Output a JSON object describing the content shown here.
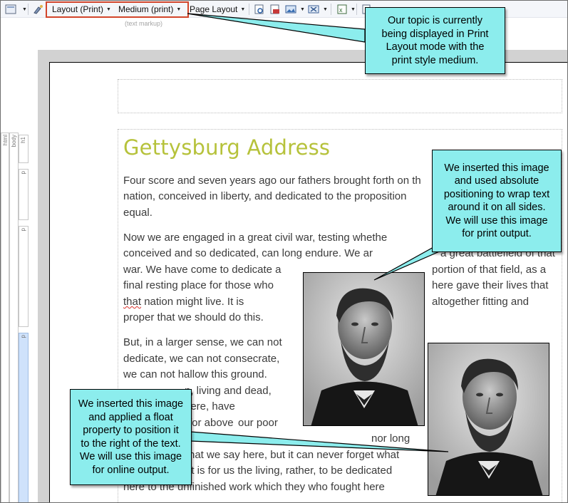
{
  "toolbar": {
    "layout_dropdown": "Layout (Print)",
    "medium_dropdown": "Medium (print)",
    "page_layout_dropdown": "Page Layout",
    "markup_label": "(text markup)"
  },
  "structure_bars": [
    "html",
    "body",
    "h1",
    "p",
    "p",
    "p"
  ],
  "document": {
    "title": "Gettysburg Address",
    "lines": [
      "Four score and seven years ago our fathers brought forth on th",
      "nation, conceived in liberty, and dedicated to the proposition",
      "equal.",
      "Now we are engaged in a great civil war, testing whethe",
      "conceived and so dedicated, can long endure. We ar",
      "war. We have come to dedicate a",
      "final resting place for those who",
      "that nation might live. It is",
      "proper that we should do this.",
      "But, in a larger sense, we can not",
      "dedicate, we can not consecrate,",
      "we can not hallow this ground.",
      "n, living and dead,",
      "here, have",
      "our poor",
      "hat we say here, but it can never forget what",
      "it is for us the living, rather, to be dedicated",
      "here to the unfinished work which they who fought here"
    ],
    "right_col": [
      "a great battlefield of that",
      "portion of that field, as a",
      "here gave their lives that",
      "altogether fitting and"
    ],
    "fragments": [
      "for above",
      "nor long"
    ],
    "misspelled_word": "that"
  },
  "callouts": {
    "print_mode": "Our topic is currently\nbeing displayed in Print\nLayout mode with the\nprint style medium.",
    "absolute_image": "We inserted this image\nand used absolute\npositioning to wrap text\naround it on all sides.\nWe will use this image\nfor print output.",
    "float_image": "We inserted this image\nand applied a float\nproperty to position it\nto the right of the text.\nWe will use this image\nfor online output."
  },
  "colors": {
    "title": "#b6c23b",
    "callout_fill": "#8ceded",
    "highlight_box": "#d2452b",
    "canvas": "#d2d2d2"
  }
}
